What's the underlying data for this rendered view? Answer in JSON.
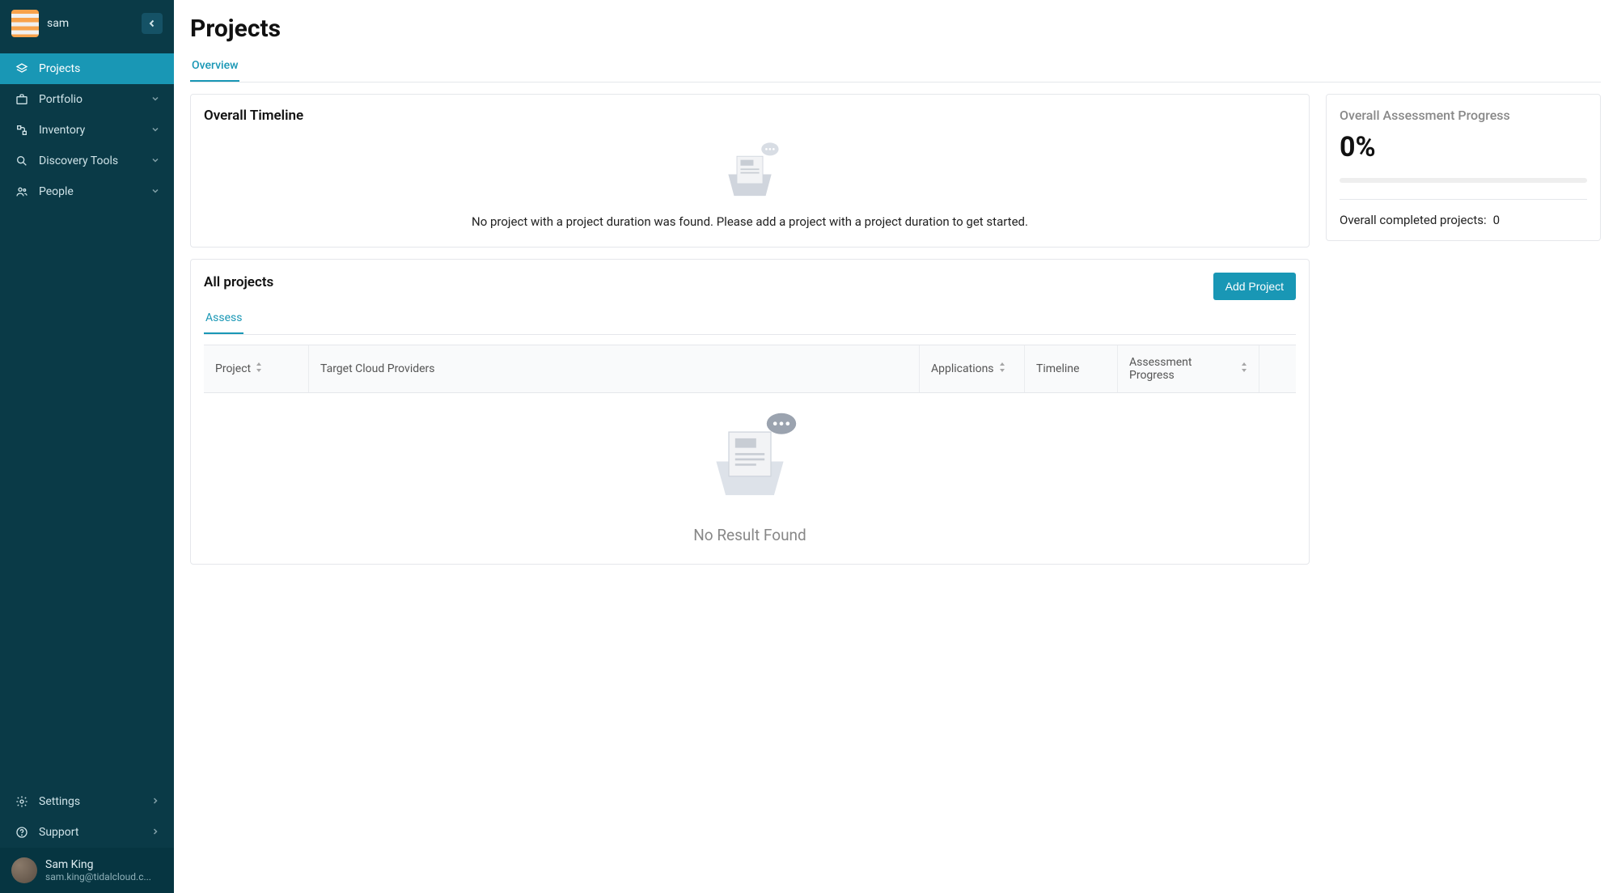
{
  "sidebar": {
    "workspace": "sam",
    "nav": {
      "projects": "Projects",
      "portfolio": "Portfolio",
      "inventory": "Inventory",
      "discovery": "Discovery Tools",
      "people": "People"
    },
    "bottom": {
      "settings": "Settings",
      "support": "Support"
    },
    "user": {
      "name": "Sam King",
      "email": "sam.king@tidalcloud.c..."
    }
  },
  "page": {
    "title": "Projects",
    "tab_overview": "Overview"
  },
  "timeline_card": {
    "title": "Overall Timeline",
    "empty": "No project with a project duration was found. Please add a project with a project duration to get started."
  },
  "progress_card": {
    "title": "Overall Assessment Progress",
    "value": "0%",
    "completed_label": "Overall completed projects:",
    "completed_value": "0"
  },
  "all_projects": {
    "title": "All projects",
    "add_button": "Add Project",
    "tab_assess": "Assess",
    "cols": {
      "project": "Project",
      "cloud": "Target Cloud Providers",
      "apps": "Applications",
      "timeline": "Timeline",
      "progress": "Assessment Progress"
    },
    "no_result": "No Result Found"
  }
}
